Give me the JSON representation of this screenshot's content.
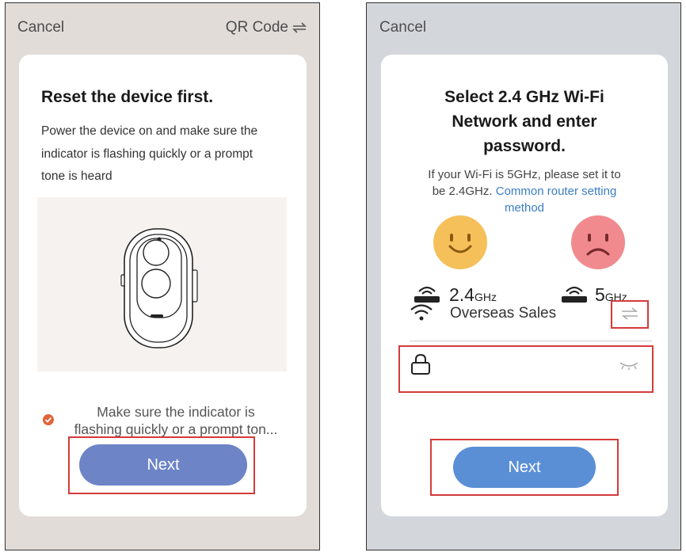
{
  "left_screen": {
    "cancel_label": "Cancel",
    "qr_code_label": "QR Code",
    "title": "Reset the device first.",
    "description": "Power the device on and make sure the indicator is flashing quickly or a prompt tone is heard",
    "confirm_text_line1": "Make sure the indicator is",
    "confirm_text_line2": "flashing quickly or a prompt ton...",
    "next_label": "Next"
  },
  "right_screen": {
    "cancel_label": "Cancel",
    "title_line1": "Select 2.4 GHz Wi-Fi",
    "title_line2": "Network and enter",
    "title_line3": "password.",
    "hint_line1": "If your Wi-Fi is 5GHz, please set it to",
    "hint_line2_prefix": "be 2.4GHz.",
    "link_line1": "Common router setting",
    "link_line2": "method",
    "band_good_number": "2.4",
    "band_good_unit": "GHz",
    "band_bad_number": "5",
    "band_bad_unit": "GHz",
    "network_name": "Overseas Sales",
    "password_value": "",
    "next_label": "Next"
  },
  "colors": {
    "accent_button": "#6d84c7",
    "accent_button_right": "#5a8fd6",
    "link": "#3b7ec4",
    "check": "#e0643a",
    "happy_face": "#f5c05a",
    "sad_face": "#f08a8e",
    "highlight_box": "#d43a3a"
  },
  "icons": [
    "swap-icon",
    "check-icon",
    "wifi-icon",
    "router-icon",
    "lock-icon",
    "eye-closed-icon",
    "happy-face-icon",
    "sad-face-icon"
  ]
}
